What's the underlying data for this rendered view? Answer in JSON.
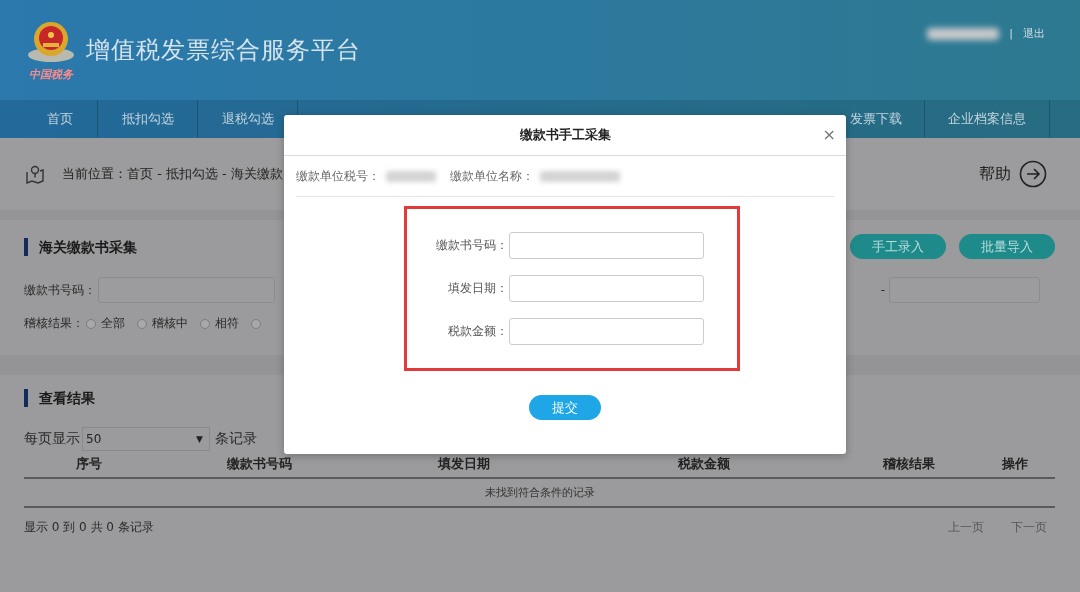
{
  "header": {
    "title": "增值税发票综合服务平台",
    "logo_caption": "中国税务",
    "separator": "|",
    "logout": "退出"
  },
  "nav": {
    "left": [
      {
        "label": "首页"
      },
      {
        "label": "抵扣勾选"
      },
      {
        "label": "退税勾选"
      }
    ],
    "right": [
      {
        "label": "发票下载"
      },
      {
        "label": "企业档案信息"
      }
    ]
  },
  "breadcrumb": {
    "text": "当前位置：首页 - 抵扣勾选 - 海关缴款",
    "help": "帮助"
  },
  "collect": {
    "title": "海关缴款书采集",
    "buttons": [
      "手工录入",
      "批量导入"
    ],
    "number_label": "缴款书号码：",
    "range_dash": "-",
    "result_label": "稽核结果：",
    "radios": [
      {
        "label": "全部",
        "selected": false
      },
      {
        "label": "稽核中",
        "selected": false
      },
      {
        "label": "相符",
        "selected": false
      },
      {
        "selected": false
      }
    ]
  },
  "results": {
    "title": "查看结果",
    "per_page_label": "每页显示",
    "per_page": "50",
    "per_page_caret": "▼",
    "per_page_suffix": "条记录",
    "columns": [
      "序号",
      "缴款书号码",
      "填发日期",
      "税款金额",
      "稽核结果",
      "操作"
    ],
    "empty": "未找到符合条件的记录",
    "summary": "显示 0 到 0 共 0 条记录",
    "prev": "上一页",
    "next": "下一页"
  },
  "modal": {
    "title": "缴款书手工采集",
    "close": "×",
    "tax_id_label": "缴款单位税号：",
    "name_label": "缴款单位名称：",
    "fields": [
      {
        "label": "缴款书号码："
      },
      {
        "label": "填发日期："
      },
      {
        "label": "税款金额："
      }
    ],
    "submit": "提交"
  }
}
